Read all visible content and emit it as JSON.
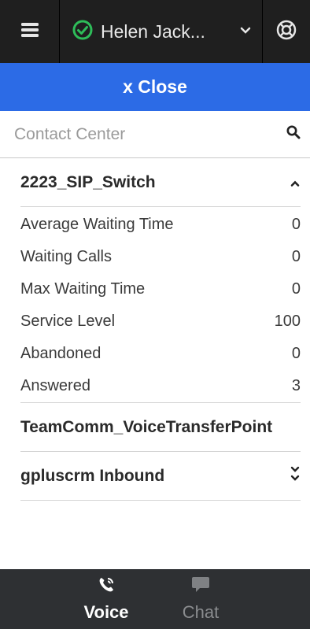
{
  "header": {
    "user_name": "Helen Jack...",
    "status": "ready",
    "status_color": "#2ebd59"
  },
  "close_label": "x Close",
  "search": {
    "placeholder": "Contact Center",
    "value": ""
  },
  "groups": [
    {
      "name": "2223_SIP_Switch",
      "expanded": true,
      "metrics": [
        {
          "label": "Average Waiting Time",
          "value": "0"
        },
        {
          "label": "Waiting Calls",
          "value": "0"
        },
        {
          "label": "Max Waiting Time",
          "value": "0"
        },
        {
          "label": "Service Level",
          "value": "100"
        },
        {
          "label": "Abandoned",
          "value": "0"
        },
        {
          "label": "Answered",
          "value": "3"
        }
      ]
    },
    {
      "name": "TeamComm_VoiceTransferPoint",
      "expanded": false
    },
    {
      "name": "gpluscrm Inbound",
      "expanded": false
    }
  ],
  "tabs": [
    {
      "label": "Voice",
      "active": true,
      "icon": "phone-icon"
    },
    {
      "label": "Chat",
      "active": false,
      "icon": "chat-icon"
    }
  ]
}
